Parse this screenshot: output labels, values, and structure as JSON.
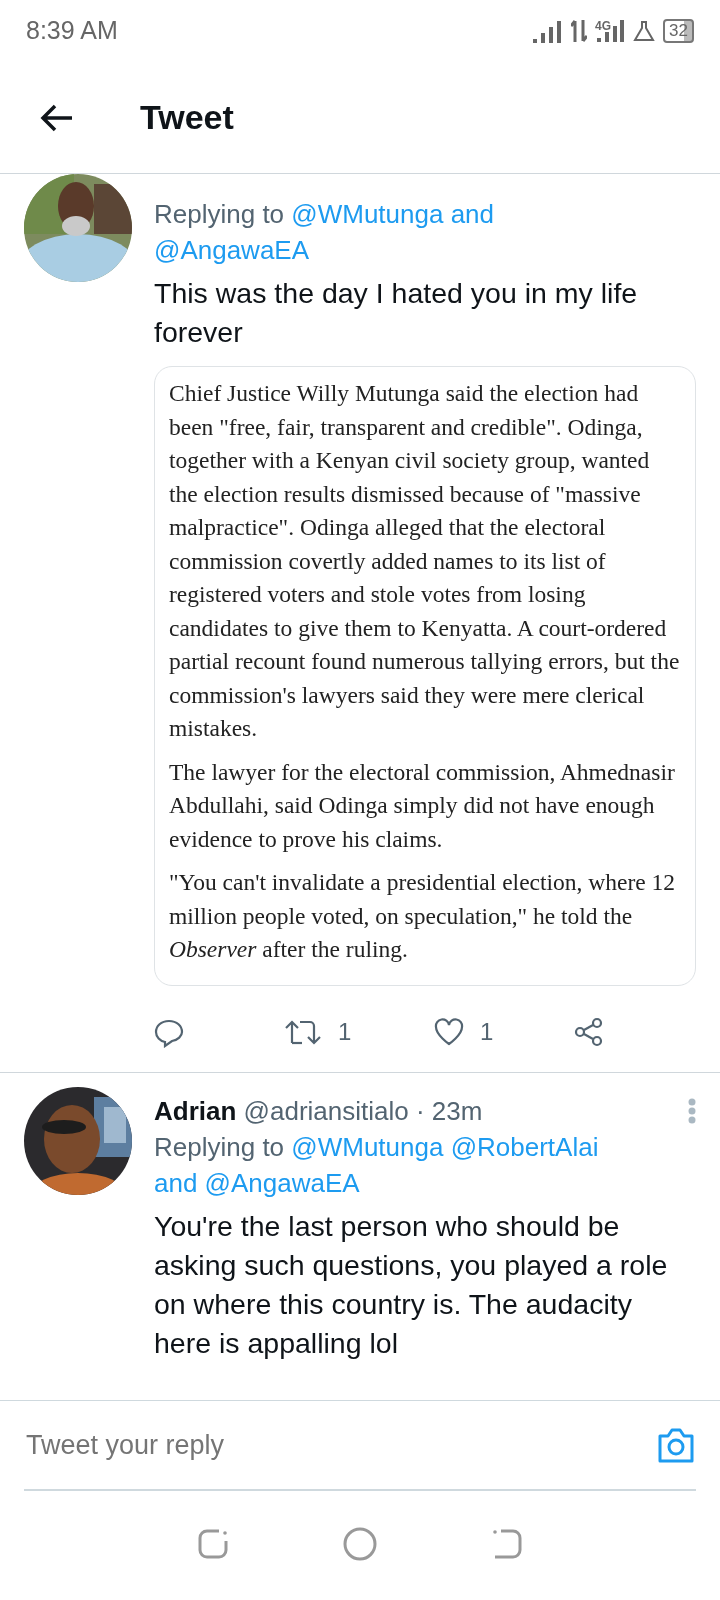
{
  "status_bar": {
    "time": "8:39 AM",
    "network": "4G",
    "battery": "32"
  },
  "app_bar": {
    "title": "Tweet"
  },
  "tweets": [
    {
      "kind": "clipped",
      "replying_prefix": "Replying to",
      "replying_to": [
        "@WMutunga and",
        "@AngawaEA"
      ],
      "text": "This was the day I hated you in my life forever",
      "quote": [
        "Chief Justice Willy Mutunga said the election had been \"free, fair, transparent and credible\". Odinga, together with a Kenyan civil society group, wanted the election results dismissed because of \"massive malpractice\". Odinga alleged that the electoral commission covertly added names to its list of registered voters and stole votes from losing candidates to give them to Kenyatta. A court-ordered partial recount found numerous tallying errors, but the commission's lawyers said they were mere clerical mistakes.",
        "The lawyer for the electoral commission, Ahmednasir Abdullahi, said Odinga simply did not have enough evidence to prove his claims.",
        "\"You can't invalidate a presidential election, where 12 million people voted, on speculation,\" he told the *Observer* after the ruling."
      ],
      "retweets": "1",
      "likes": "1"
    },
    {
      "kind": "full",
      "name": "Adrian",
      "handle": "@adriansitialo",
      "time": "· 23m",
      "replying_prefix": "Replying to",
      "replying_to": [
        "@WMutunga @RobertAlai",
        "and @AngawaEA"
      ],
      "text": "You're the last person who should be asking such questions, you played a role on where this country is. The audacity here is appalling lol"
    }
  ],
  "reply_bar": {
    "placeholder": "Tweet your reply"
  }
}
